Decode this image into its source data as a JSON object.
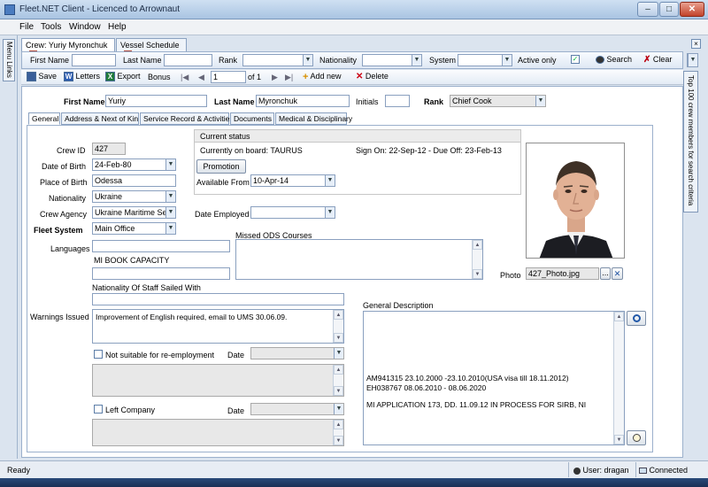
{
  "window": {
    "title": "Fleet.NET Client - Licenced to Arrownaut",
    "min": "–",
    "max": "□",
    "close": "✕"
  },
  "menu": [
    "File",
    "Tools",
    "Window",
    "Help"
  ],
  "side_left": {
    "menu_links": "Menu Links"
  },
  "side_right": {
    "label": "Top 100 crew members for search criteria"
  },
  "tabs": [
    {
      "label": "Crew: Yuriy Myronchuk",
      "close": "×"
    },
    {
      "label": "Vessel Schedule",
      "close": "×"
    }
  ],
  "pane_close": "×",
  "search": {
    "first_name": "First Name",
    "last_name": "Last Name",
    "rank": "Rank",
    "nationality": "Nationality",
    "system": "System",
    "active_only": "Active only",
    "active_checked": "✓",
    "search_btn": "Search",
    "clear_btn": "Clear"
  },
  "toolbar": {
    "save": "Save",
    "letters": "Letters",
    "export": "Export",
    "bonus": "Bonus",
    "page": "1",
    "of": "of 1",
    "add_new": "Add new",
    "delete": "Delete"
  },
  "header": {
    "first_name_lbl": "First Name",
    "first_name": "Yuriy",
    "last_name_lbl": "Last Name",
    "last_name": "Myronchuk",
    "initials_lbl": "Initials",
    "initials": "",
    "rank_lbl": "Rank",
    "rank": "Chief Cook"
  },
  "subtabs": [
    "General",
    "Address & Next of Kin",
    "Service Record & Activities",
    "Documents",
    "Medical & Disciplinary"
  ],
  "general": {
    "crew_id_lbl": "Crew ID",
    "crew_id": "427",
    "dob_lbl": "Date of Birth",
    "dob": "24-Feb-80",
    "pob_lbl": "Place of Birth",
    "pob": "Odessa",
    "nationality_lbl": "Nationality",
    "nationality": "Ukraine",
    "agency_lbl": "Crew Agency",
    "agency": "Ukraine Maritime Se...",
    "fleet_lbl": "Fleet System",
    "fleet": "Main Office",
    "languages_lbl": "Languages",
    "languages": "",
    "mi_book_lbl": "MI BOOK CAPACITY",
    "mi_book": "",
    "staff_nat_lbl": "Nationality Of Staff Sailed With",
    "staff_nat": "",
    "warnings_lbl": "Warnings Issued",
    "warnings": "Improvement of English required, email to UMS 30.06.09.",
    "not_suitable_lbl": "Not suitable for re-employment",
    "date_lbl": "Date",
    "left_company_lbl": "Left Company",
    "date2_lbl": "Date"
  },
  "status": {
    "header": "Current status",
    "on_board": "Currently on board: TAURUS",
    "sign_on": "Sign On: 22-Sep-12 - Due Off: 23-Feb-13",
    "promotion_btn": "Promotion",
    "available_lbl": "Available From",
    "available": "10-Apr-14",
    "employed_lbl": "Date Employed",
    "employed": ""
  },
  "ods": {
    "label": "Missed ODS Courses"
  },
  "photo": {
    "label": "Photo",
    "file": "427_Photo.jpg",
    "browse": "...",
    "remove": "✕"
  },
  "desc": {
    "label": "General Description",
    "line1": "AM941315  23.10.2000 -23.10.2010(USA visa till 18.11.2012)",
    "line2": "EH038767  08.06.2010 - 08.06.2020",
    "line3": "MI APPLICATION 173, DD. 11.09.12 IN PROCESS FOR SIRB,  NI"
  },
  "statusbar": {
    "ready": "Ready",
    "user": "User: dragan",
    "connected": "Connected"
  },
  "colors": {
    "accent": "#4a7cc0",
    "panel_bg": "#dbe4ef"
  }
}
